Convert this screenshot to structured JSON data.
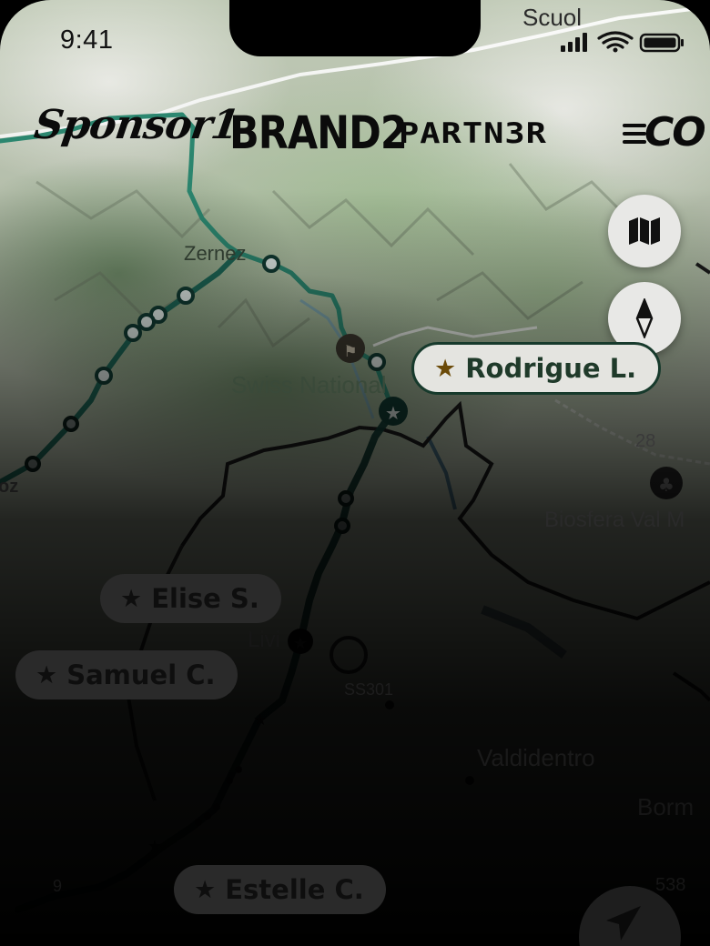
{
  "status_bar": {
    "time": "9:41"
  },
  "sponsors": [
    {
      "label": "Sponsor1"
    },
    {
      "label": "BRAND2"
    },
    {
      "label": "PARTN3R"
    },
    {
      "label": "CO"
    }
  ],
  "map": {
    "place_labels": {
      "scuol": "Scuol",
      "zernez": "Zernez",
      "swiss_national": "Swiss National",
      "biosfera": "Biosfera Val M",
      "livigno": "Livi",
      "valdidentro": "Valdidentro",
      "bormio": "Borm",
      "oz": "oz",
      "road_28": "28",
      "road_ss301": "SS301",
      "road_538": "538",
      "num_9": "9"
    }
  },
  "controls": {
    "map_layers": "map-layers",
    "compass": "compass",
    "locate": "locate"
  },
  "riders": [
    {
      "name": "Rodrigue L.",
      "icon": "star-icon",
      "active": true
    },
    {
      "name": "Elise S.",
      "icon": "star-icon",
      "active": false
    },
    {
      "name": "Samuel C.",
      "icon": "star-icon",
      "active": false
    },
    {
      "name": "Estelle C.",
      "icon": "star-icon",
      "active": false
    }
  ],
  "colors": {
    "route": "#2d8b73",
    "route_dark": "#123d34",
    "active_chip_text": "#1f3a2a",
    "active_star": "#6b4a08"
  }
}
